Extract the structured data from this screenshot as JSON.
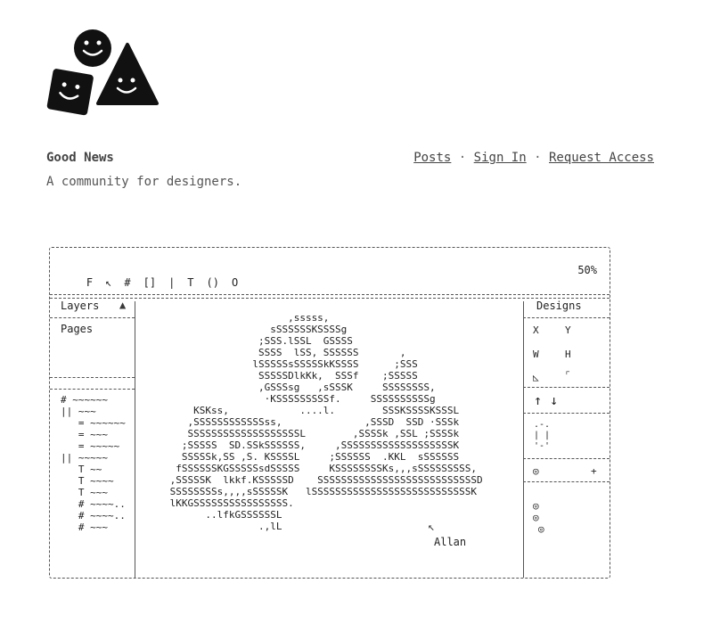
{
  "header": {
    "logo_alt": "smiley shapes logo",
    "brand": "Good News",
    "tagline": "A community for designers.",
    "nav": [
      {
        "label": "Posts"
      },
      {
        "label": "Sign In"
      },
      {
        "label": "Request Access"
      }
    ],
    "nav_separator": "·"
  },
  "editor": {
    "toolbar": {
      "tools": [
        "F",
        "↖",
        "#",
        "[]",
        "|",
        "T",
        "()",
        "O"
      ],
      "zoom": "50%"
    },
    "layers": {
      "title": "Layers",
      "caret": "▲",
      "pages_label": "Pages",
      "items": [
        "# ~~~~~~",
        "|| ~~~",
        "   = ~~~~~~",
        "   = ~~~",
        "   = ~~~~~",
        "|| ~~~~~",
        "   T ~~",
        "   T ~~~~",
        "   T ~~~",
        "   # ~~~~..",
        "   # ~~~~..",
        "   # ~~~"
      ]
    },
    "canvas": {
      "art_lines": [
        "                     ,sssss,",
        "                  sSSSSSSKSSSSg",
        "                ;SSS.lSSL  GSSSS",
        "                SSSS  lSS, SSSSSS       ,",
        "               lSSSSSsSSSSSkKSSSS      ;SSS",
        "                SSSSSDlkKk,  SSSf    ;SSSSS",
        "                ,GSSSsg   ,sSSSK     SSSSSSSS,",
        "                 ·KSSSSSSSSSf.     SSSSSSSSSSg",
        "     KSKss,            ....l.        SSSKSSSSKSSSL",
        "    ,SSSSSSSSSSSSss,              ,SSSD  SSD ·SSSk",
        "    SSSSSSSSSSSSSSSSSSSL        ,SSSSk ,SSL ;SSSSk",
        "   ;SSSSS  SD.SSkSSSSSS,     ,SSSSSSSSSSSSSSSSSSSK",
        "   SSSSSk,SS ,S. KSSSSL     ;SSSSSS  .KKL  sSSSSSS",
        "  fSSSSSSKGSSSSSsdSSSSS     KSSSSSSSSKs,,,sSSSSSSSSS,",
        " ,SSSSSK  lkkf.KSSSSSD    SSSSSSSSSSSSSSSSSSSSSSSSSSSD",
        " SSSSSSSSs,,,,sSSSSSK   lSSSSSSSSSSSSSSSSSSSSSSSSSSSK",
        " lKKGSSSSSSSSSSSSSSSS.",
        "       ..lfkGSSSSSSL",
        "                .,lL"
      ],
      "cursor": "↖",
      "collaborator": "Allan"
    },
    "designs": {
      "title": "Designs",
      "x_label": "X",
      "y_label": "Y",
      "w_label": "W",
      "h_label": "H",
      "angle_label": "◺",
      "radius_label": "⌜",
      "up_arrow": "↑",
      "down_arrow": "↓",
      "align_box": ".-.\n| |\n'-'",
      "fill_icon": "◎",
      "add": "+",
      "extra_fills": [
        "◎",
        "◎",
        "◎"
      ]
    }
  }
}
